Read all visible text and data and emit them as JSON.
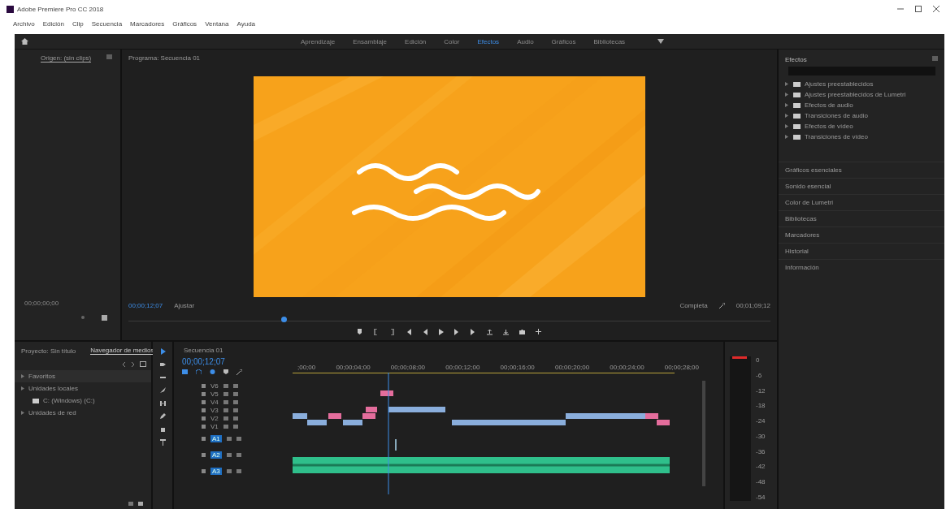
{
  "window": {
    "title": "Adobe Premiere Pro CC 2018"
  },
  "menu": [
    "Archivo",
    "Edición",
    "Clip",
    "Secuencia",
    "Marcadores",
    "Gráficos",
    "Ventana",
    "Ayuda"
  ],
  "workspaces": [
    {
      "label": "Aprendizaje",
      "selected": false
    },
    {
      "label": "Ensamblaje",
      "selected": false
    },
    {
      "label": "Edición",
      "selected": false
    },
    {
      "label": "Color",
      "selected": false
    },
    {
      "label": "Efectos",
      "selected": true
    },
    {
      "label": "Audio",
      "selected": false
    },
    {
      "label": "Gráficos",
      "selected": false
    },
    {
      "label": "Bibliotecas",
      "selected": false
    }
  ],
  "source": {
    "tab": "Origen: (sin clips)",
    "timecode": "00;00;00;00"
  },
  "program": {
    "tab": "Programa: Secuencia 01",
    "timecode": "00;00;12;07",
    "zoom": "Ajustar",
    "quality": "Completa",
    "duration": "00;01;09;12"
  },
  "effects": {
    "title": "Efectos",
    "folders": [
      "Ajustes preestablecidos",
      "Ajustes preestablecidos de Lumetri",
      "Efectos de audio",
      "Transiciones de audio",
      "Efectos de vídeo",
      "Transiciones de vídeo"
    ],
    "sections": [
      "Gráficos esenciales",
      "Sonido esencial",
      "Color de Lumetri",
      "Bibliotecas",
      "Marcadores",
      "Historial",
      "Información"
    ]
  },
  "project": {
    "tabs": [
      {
        "label": "Proyecto: Sin título",
        "selected": false
      },
      {
        "label": "Navegador de medios",
        "selected": true
      }
    ],
    "tree": [
      {
        "label": "Favoritos"
      },
      {
        "label": "Unidades locales",
        "children": [
          {
            "label": "C: (Windows) (C:)"
          }
        ]
      },
      {
        "label": "Unidades de red"
      }
    ]
  },
  "timeline": {
    "tab": "Secuencia 01",
    "timecode": "00;00;12;07",
    "ruler": [
      ";00;00",
      "00;00;04;00",
      "00;00;08;00",
      "00;00;12;00",
      "00;00;16;00",
      "00;00;20;00",
      "00;00;24;00",
      "00;00;28;00"
    ],
    "video_tracks": [
      "V6",
      "V5",
      "V4",
      "V3",
      "V2",
      "V1"
    ],
    "audio_tracks": [
      "A1",
      "A2",
      "A3"
    ]
  },
  "meter_ticks": [
    "0",
    "-6",
    "-12",
    "-18",
    "-24",
    "-30",
    "-36",
    "-42",
    "-48",
    "-54"
  ]
}
